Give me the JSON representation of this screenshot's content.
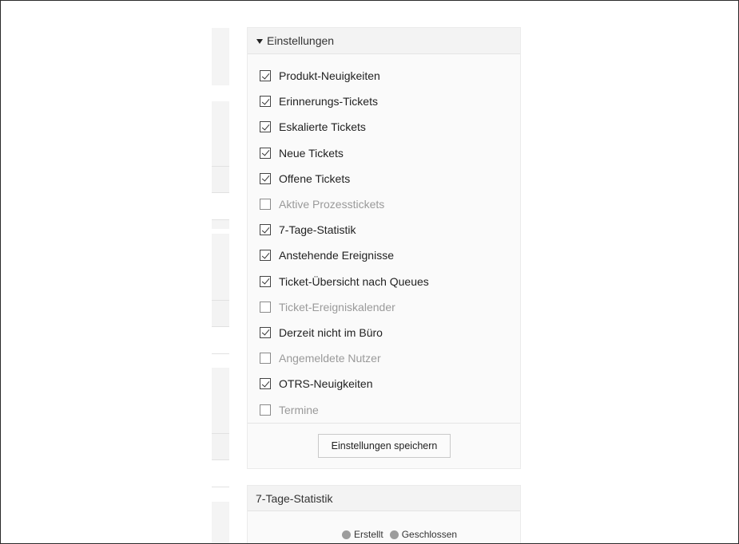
{
  "settings": {
    "header_title": "Einstellungen",
    "items": [
      {
        "label": "Produkt-Neuigkeiten",
        "checked": true
      },
      {
        "label": "Erinnerungs-Tickets",
        "checked": true
      },
      {
        "label": "Eskalierte Tickets",
        "checked": true
      },
      {
        "label": "Neue Tickets",
        "checked": true
      },
      {
        "label": "Offene Tickets",
        "checked": true
      },
      {
        "label": "Aktive Prozesstickets",
        "checked": false
      },
      {
        "label": "7-Tage-Statistik",
        "checked": true
      },
      {
        "label": "Anstehende Ereignisse",
        "checked": true
      },
      {
        "label": "Ticket-Übersicht nach Queues",
        "checked": true
      },
      {
        "label": "Ticket-Ereigniskalender",
        "checked": false
      },
      {
        "label": "Derzeit nicht im Büro",
        "checked": true
      },
      {
        "label": "Angemeldete Nutzer",
        "checked": false
      },
      {
        "label": "OTRS-Neuigkeiten",
        "checked": true
      },
      {
        "label": "Termine",
        "checked": false
      }
    ],
    "save_label": "Einstellungen speichern"
  },
  "stats_widget": {
    "title": "7-Tage-Statistik",
    "legend": [
      "Erstellt",
      "Geschlossen"
    ]
  }
}
